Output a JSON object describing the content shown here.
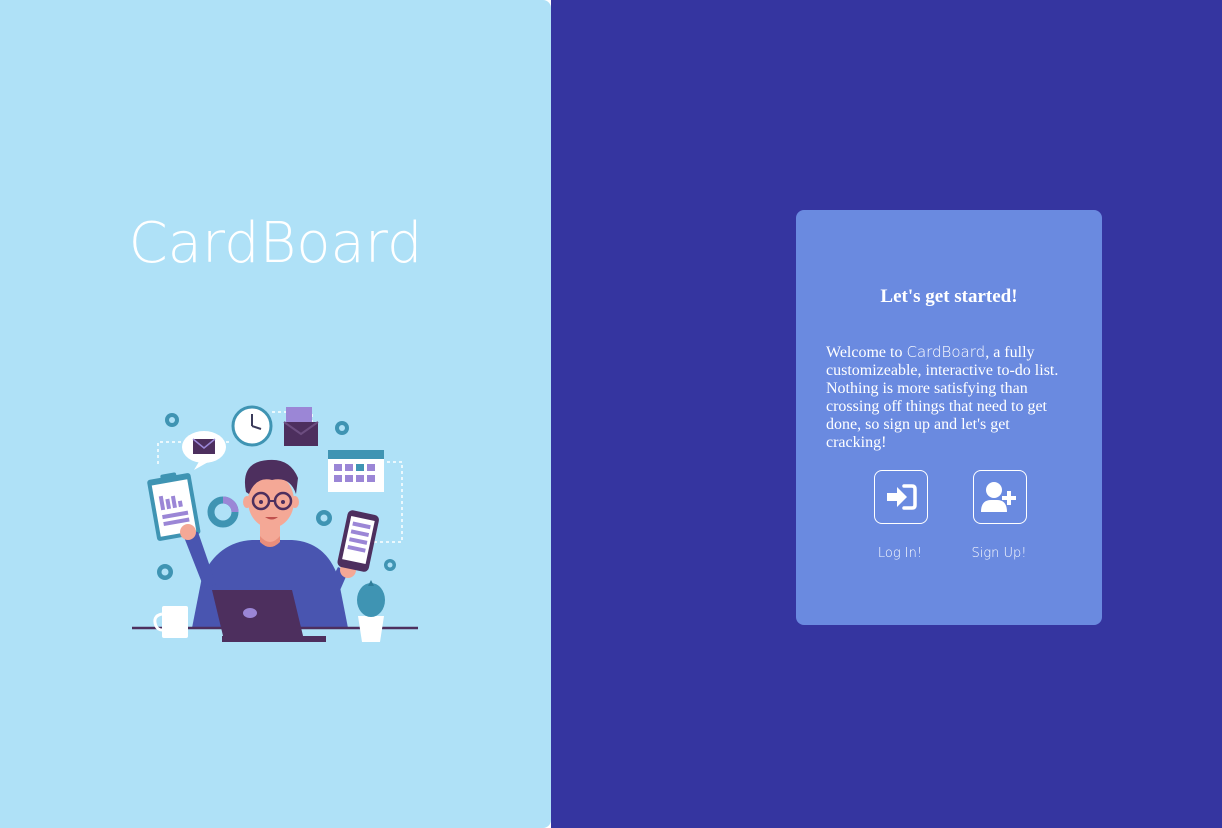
{
  "brand": {
    "name": "CardBoard"
  },
  "card": {
    "heading": "Let's get started!",
    "body_prefix": "Welcome to ",
    "body_brand": "CardBoard",
    "body_suffix": ", a fully customizeable, interactive to-do list. Nothing is more satisfying than crossing off things that need to get done, so sign up and let's get cracking!"
  },
  "actions": {
    "login": {
      "label": "Log In!",
      "icon": "sign-in-icon"
    },
    "signup": {
      "label": "Sign Up!",
      "icon": "user-plus-icon"
    }
  },
  "colors": {
    "left_panel": "#afe1f7",
    "right_panel": "#3535a0",
    "card": "#6a8ae0",
    "text": "#ffffff"
  }
}
